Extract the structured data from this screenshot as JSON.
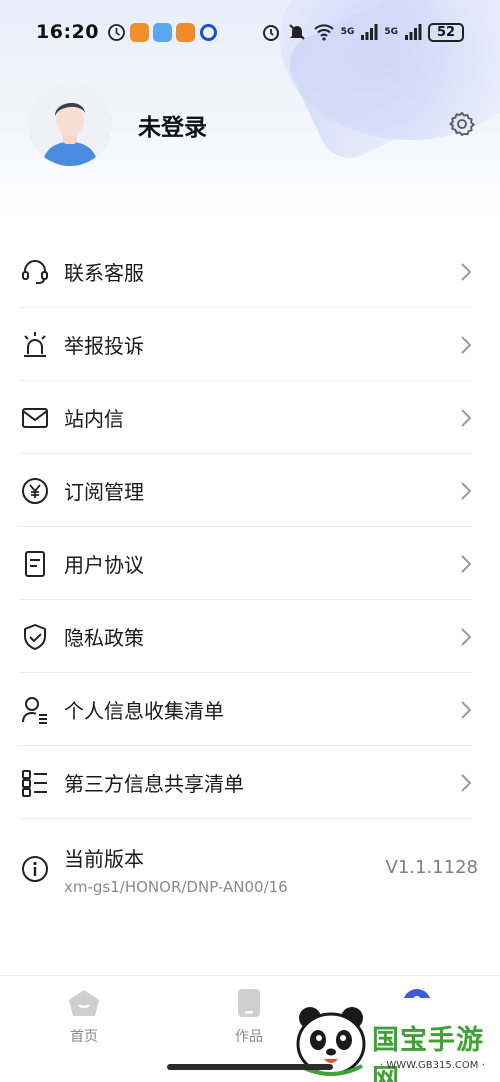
{
  "status_bar": {
    "time": "16:20",
    "battery": "52",
    "network_labels": [
      "5G",
      "5G"
    ]
  },
  "profile": {
    "username": "未登录"
  },
  "menu": {
    "items": [
      {
        "label": "联系客服",
        "icon": "headset-icon"
      },
      {
        "label": "举报投诉",
        "icon": "alarm-light-icon"
      },
      {
        "label": "站内信",
        "icon": "mail-icon"
      },
      {
        "label": "订阅管理",
        "icon": "yen-coin-icon"
      },
      {
        "label": "用户协议",
        "icon": "document-icon"
      },
      {
        "label": "隐私政策",
        "icon": "shield-check-icon"
      },
      {
        "label": "个人信息收集清单",
        "icon": "person-list-icon"
      },
      {
        "label": "第三方信息共享清单",
        "icon": "list-icon"
      }
    ],
    "version": {
      "label": "当前版本",
      "detail": "xm-gs1/HONOR/DNP-AN00/16",
      "number": "V1.1.1128"
    }
  },
  "tabbar": {
    "tabs": [
      {
        "label": "首页",
        "icon": "home-icon"
      },
      {
        "label": "作品",
        "icon": "phone-icon"
      },
      {
        "label": "",
        "icon": "profile-icon"
      }
    ]
  },
  "watermark": {
    "text": "国宝手游网",
    "url": "· WWW.GB315.COM ·"
  },
  "colors": {
    "accent": "#3d5bd9",
    "watermark_green": "#3fa236"
  }
}
